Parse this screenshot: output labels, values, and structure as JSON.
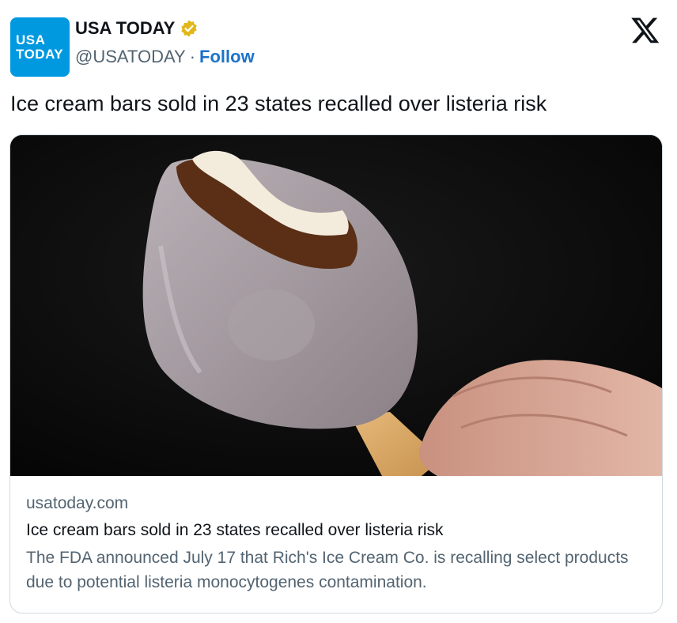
{
  "account": {
    "avatar_line1": "USA",
    "avatar_line2": "TODAY",
    "name": "USA TODAY",
    "handle": "@USATODAY",
    "separator": "·",
    "follow_label": "Follow"
  },
  "tweet": {
    "text": "Ice cream bars sold in 23 states recalled over listeria risk"
  },
  "card": {
    "domain": "usatoday.com",
    "title": "Ice cream bars sold in 23 states recalled over listeria risk",
    "description": "The FDA announced July 17 that Rich's Ice Cream Co. is recalling select products due to potential listeria monocytogenes contamination."
  },
  "colors": {
    "brand": "#0099e0",
    "follow": "#1d73c9",
    "verified": "#e2b719",
    "muted_text": "#536471"
  },
  "icons": [
    "verified-badge-icon",
    "x-logo-icon"
  ]
}
